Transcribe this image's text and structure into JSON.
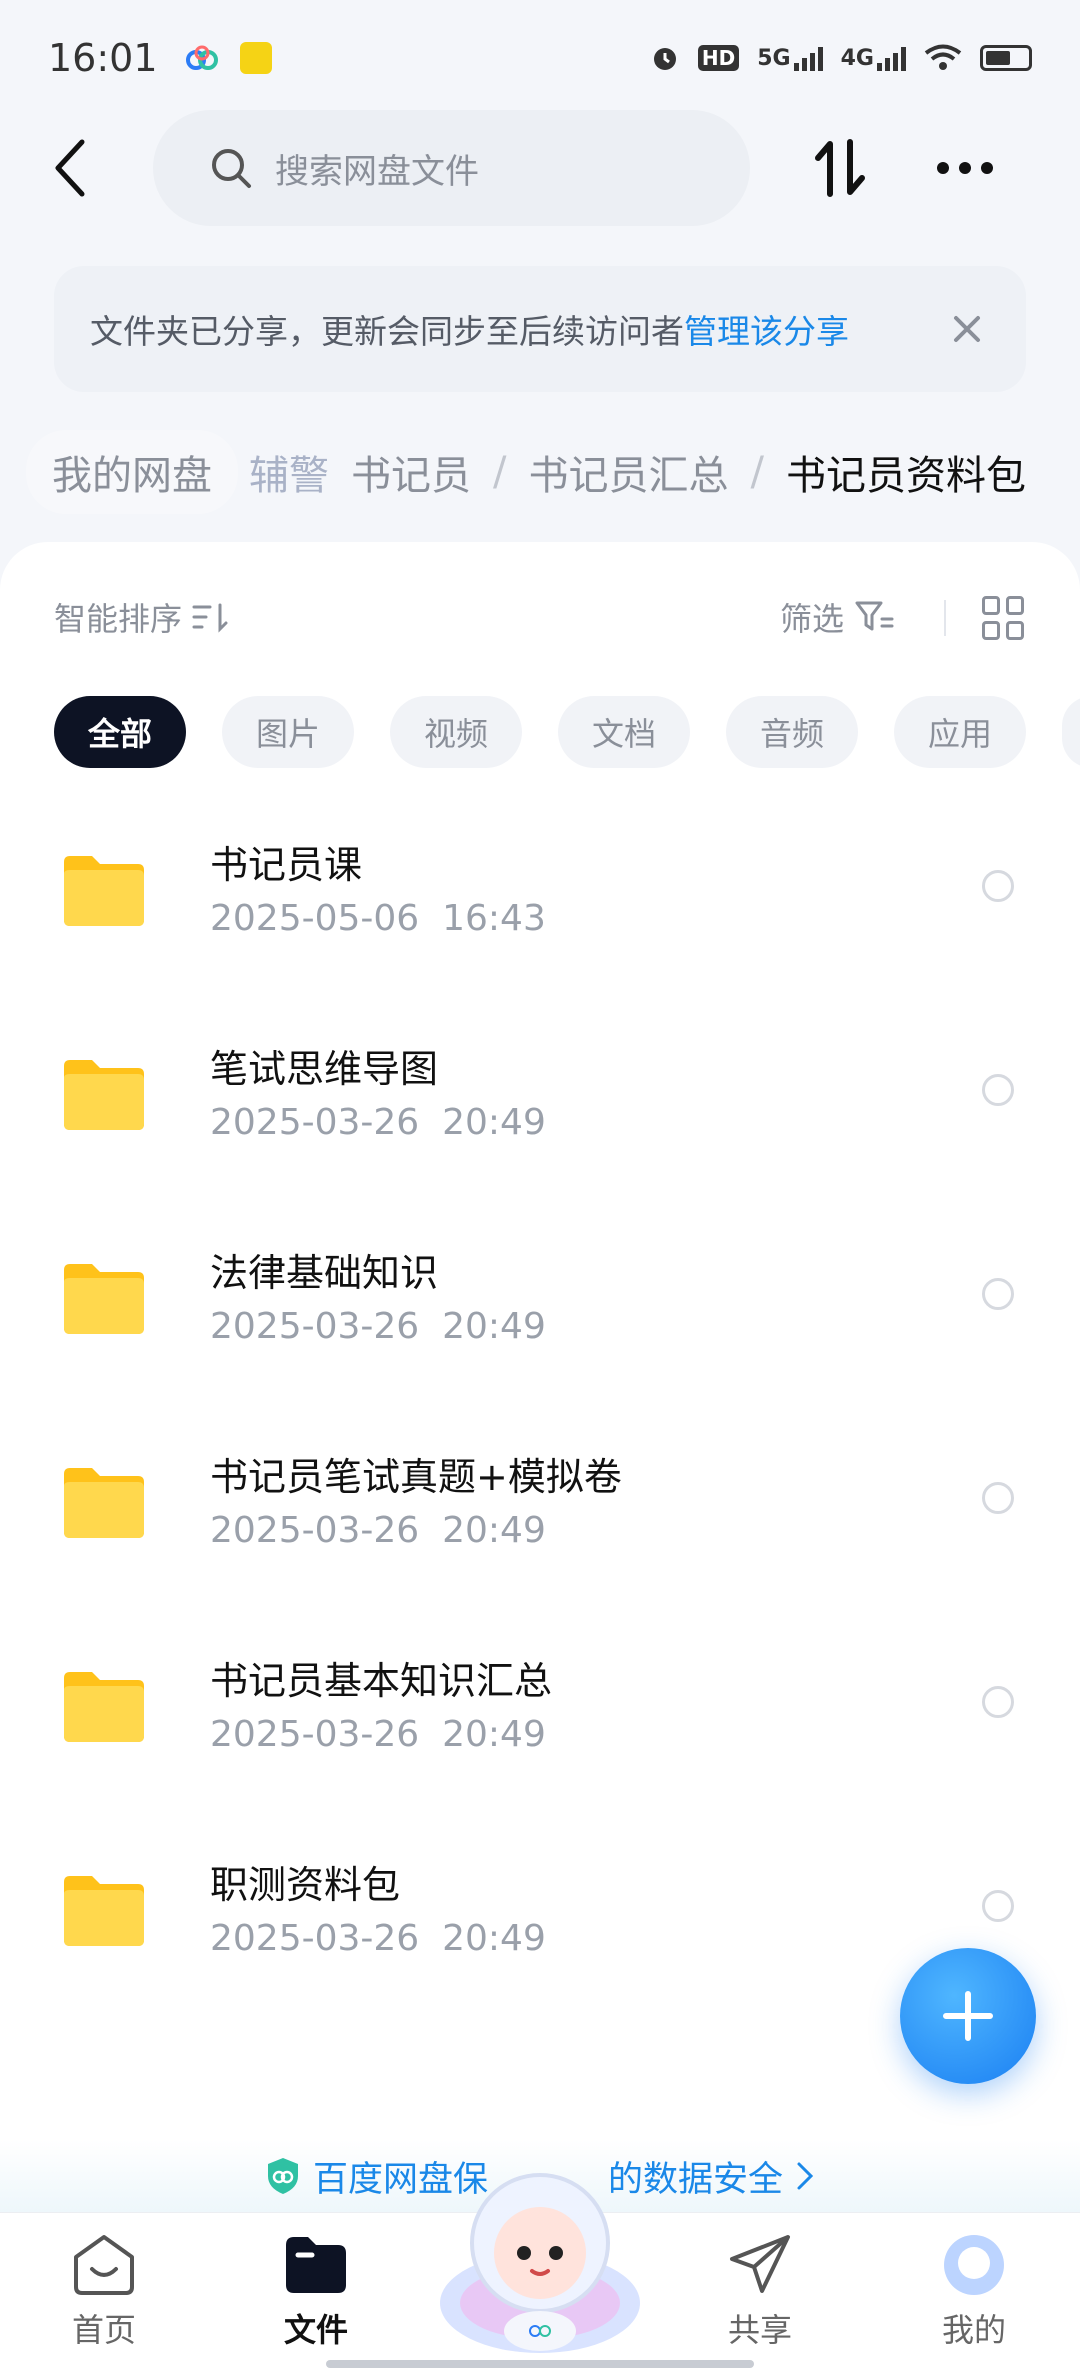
{
  "status_bar": {
    "time": "16:01",
    "icons": [
      "baidu-netdisk-icon",
      "app-notification-icon",
      "alarm-icon",
      "hd-icon",
      "5g-signal-icon",
      "4g-signal-icon",
      "wifi-icon",
      "battery-icon"
    ],
    "hd_label": "HD",
    "net1": "5G",
    "net2": "4G"
  },
  "top_bar": {
    "search_placeholder": "搜索网盘文件"
  },
  "share_banner": {
    "text": "文件夹已分享，更新会同步至后续访问者",
    "link": "管理该分享"
  },
  "breadcrumb": {
    "root": "我的网盘",
    "items": [
      "辅警",
      "书记员",
      "书记员汇总"
    ],
    "current": "书记员资料包"
  },
  "toolbar": {
    "sort_label": "智能排序",
    "filter_label": "筛选"
  },
  "chips": [
    "全部",
    "图片",
    "视频",
    "文档",
    "音频",
    "应用"
  ],
  "files": [
    {
      "name": "书记员课",
      "date": "2025-05-06  16:43"
    },
    {
      "name": "笔试思维导图",
      "date": "2025-03-26  20:49"
    },
    {
      "name": "法律基础知识",
      "date": "2025-03-26  20:49"
    },
    {
      "name": "书记员笔试真题+模拟卷",
      "date": "2025-03-26  20:49"
    },
    {
      "name": "书记员基本知识汇总",
      "date": "2025-03-26  20:49"
    },
    {
      "name": "职测资料包",
      "date": "2025-03-26  20:49"
    }
  ],
  "safety_banner": {
    "text_start": "百度网盘保",
    "text_end": "的数据安全"
  },
  "bottom_nav": {
    "home": "首页",
    "files": "文件",
    "share": "共享",
    "mine": "我的"
  },
  "colors": {
    "accent": "#1a88e8",
    "folder": "#ffcd2e",
    "active_chip": "#0d1324"
  }
}
